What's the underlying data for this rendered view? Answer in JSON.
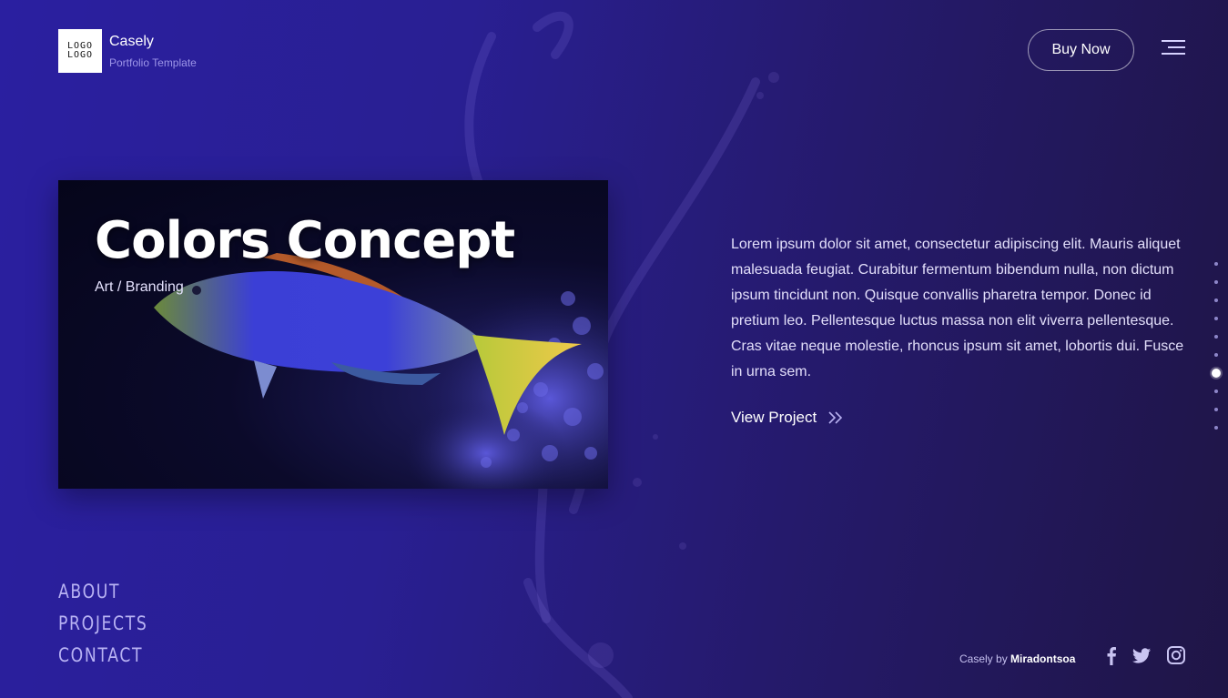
{
  "header": {
    "logo_line1": "LOGO",
    "logo_line2": "LOGO",
    "brand_name": "Casely",
    "brand_sub": "Portfolio Template",
    "buy_label": "Buy Now"
  },
  "hero": {
    "title": "Colors Concept",
    "subtitle": "Art / Branding",
    "description": "Lorem ipsum dolor sit amet, consectetur adipiscing elit. Mauris aliquet malesuada feugiat. Curabitur fermentum bibendum nulla, non dictum ipsum tincidunt non. Quisque convallis pharetra tempor. Donec id pretium leo. Pellentesque luctus massa non elit viverra pellentesque. Cras vitae neque molestie, rhoncus ipsum sit amet, lobortis dui. Fusce in urna sem.",
    "view_label": "View Project"
  },
  "pagination": {
    "total": 10,
    "active_index": 6
  },
  "nav": {
    "items": [
      "ABOUT",
      "PROJECTS",
      "CONTACT"
    ]
  },
  "footer": {
    "credit_prefix": "Casely by",
    "credit_author": "Miradontsoa"
  },
  "social": {
    "icons": [
      "facebook-icon",
      "twitter-icon",
      "instagram-icon"
    ]
  },
  "colors": {
    "accent": "#2a1fa0",
    "text_muted": "#9d95e8"
  }
}
